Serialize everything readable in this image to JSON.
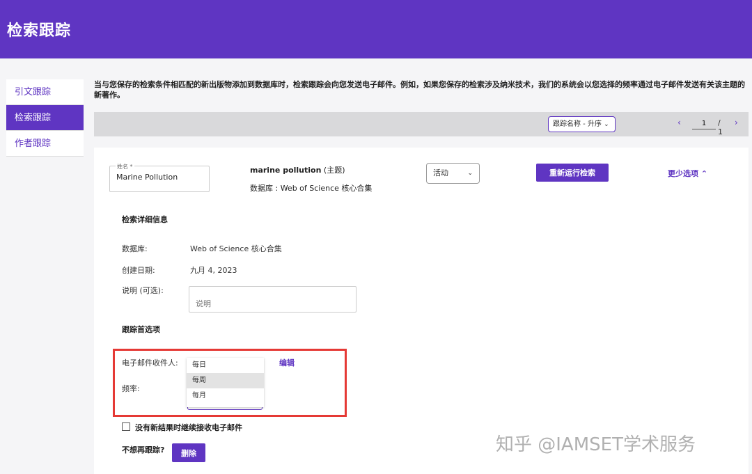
{
  "header": {
    "title": "检索跟踪"
  },
  "sidebar": {
    "items": [
      {
        "label": "引文跟踪"
      },
      {
        "label": "检索跟踪"
      },
      {
        "label": "作者跟踪"
      }
    ]
  },
  "intro": {
    "text": "当与您保存的检索条件相匹配的新出版物添加到数据库时，检索跟踪会向您发送电子邮件。例如，如果您保存的检索涉及纳米技术，我们的系统会以您选择的频率通过电子邮件发送有关该主题的新著作。"
  },
  "toolbar": {
    "sort_label": "跟踪名称 - 升序",
    "page_value": "1",
    "page_total": "/ 1",
    "prev": "‹",
    "next": "›"
  },
  "card": {
    "name_label": "姓名 *",
    "name_value": "Marine Pollution",
    "query_term": "marine pollution",
    "query_type": " (主题)",
    "database_line": "数据库 : Web of Science 核心合集",
    "status_value": "活动",
    "rerun_button": "重新运行检索",
    "more_link": "更少选项 ⌃",
    "details_title": "检索详细信息",
    "database_label": "数据库:",
    "database_value": "Web of Science 核心合集",
    "created_label": "创建日期:",
    "created_value": "九月 4, 2023",
    "desc_label": "说明 (可选):",
    "desc_placeholder": "说明",
    "prefs_title": "跟踪首选项",
    "email_label": "电子邮件收件人:",
    "edit_link": "编辑",
    "freq_label": "频率:",
    "freq_options": [
      "每日",
      "每周",
      "每月"
    ],
    "checkbox_label": "没有新结果时继续接收电子邮件",
    "untrack_label": "不想再跟踪?",
    "delete_button": "删除"
  },
  "watermark": {
    "text": "知乎 @IAMSET学术服务"
  }
}
